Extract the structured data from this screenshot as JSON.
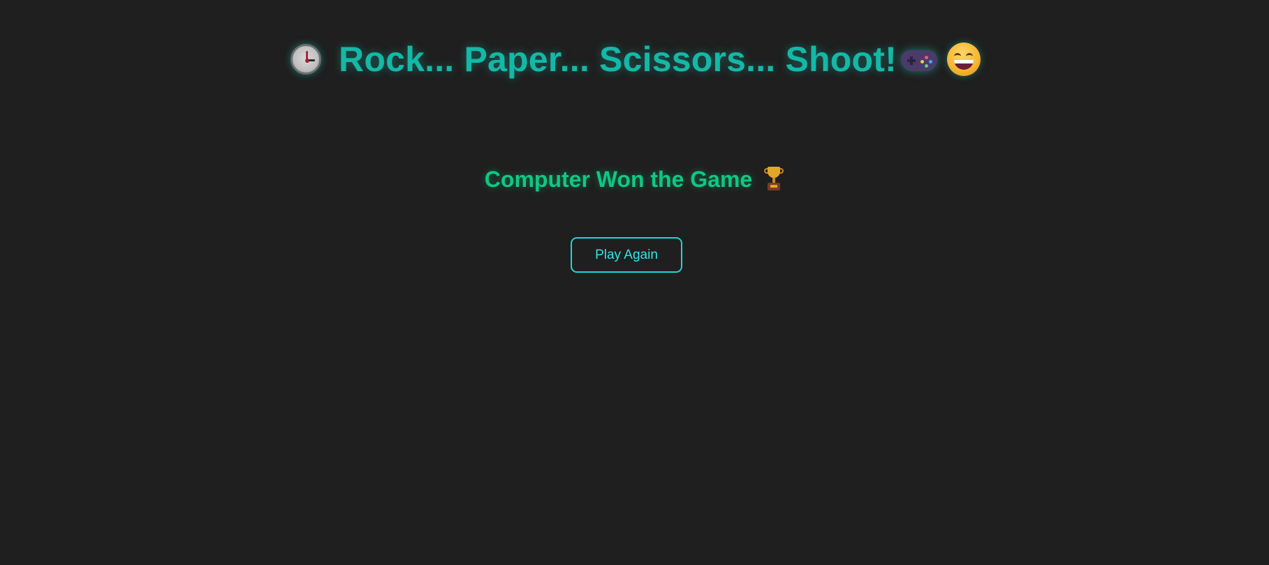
{
  "header": {
    "title": "Rock... Paper... Scissors... Shoot!",
    "icons": [
      "clock-icon",
      "gamepad-icon",
      "grinning-face-icon"
    ]
  },
  "result": {
    "message": "Computer Won the Game",
    "icon": "trophy-icon"
  },
  "actions": {
    "play_again_label": "Play Again"
  },
  "colors": {
    "background": "#1f1f1f",
    "title": "#14b8a6",
    "result": "#10c784",
    "button": "#1fd6d6"
  }
}
